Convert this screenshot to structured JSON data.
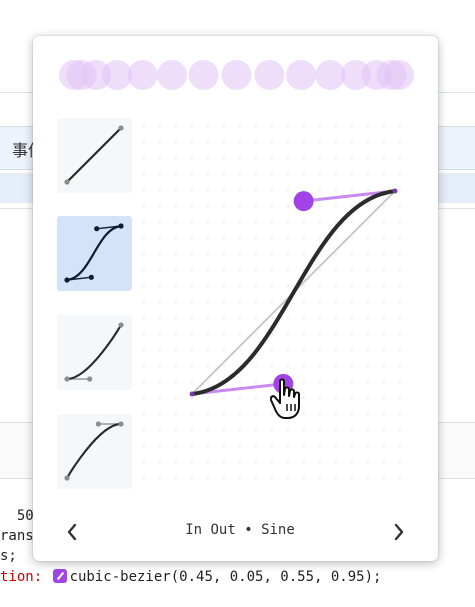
{
  "background": {
    "tab_label": "事件",
    "code_lines": {
      "line1": "  50",
      "line2": "rans",
      "line3": "s;",
      "line4_prop": "tion: ",
      "line4_value": "cubic-bezier(0.45, 0.05, 0.55, 0.95);"
    }
  },
  "popup": {
    "easing_name": "In Out",
    "separator": "•",
    "easing_family": "Sine",
    "curve": {
      "p1": [
        0.45,
        0.05
      ],
      "p2": [
        0.55,
        0.95
      ]
    },
    "presets": [
      {
        "name": "linear",
        "p1": [
          0.0,
          0.0
        ],
        "p2": [
          1.0,
          1.0
        ]
      },
      {
        "name": "ease-in-out",
        "p1": [
          0.45,
          0.05
        ],
        "p2": [
          0.55,
          0.95
        ],
        "selected": true
      },
      {
        "name": "ease-in",
        "p1": [
          0.42,
          0.0
        ],
        "p2": [
          1.0,
          1.0
        ]
      },
      {
        "name": "ease-out",
        "p1": [
          0.0,
          0.0
        ],
        "p2": [
          0.58,
          1.0
        ]
      }
    ],
    "prev_icon": "chevron-left-icon",
    "next_icon": "chevron-right-icon"
  },
  "colors": {
    "accent": "#a244e6",
    "handle_line": "#c98af0",
    "curve": "#2b2b2b",
    "diagonal": "#c8c8c8",
    "preview_dot": "#e2c3f6",
    "selected_preset": "#d4e3f8"
  }
}
